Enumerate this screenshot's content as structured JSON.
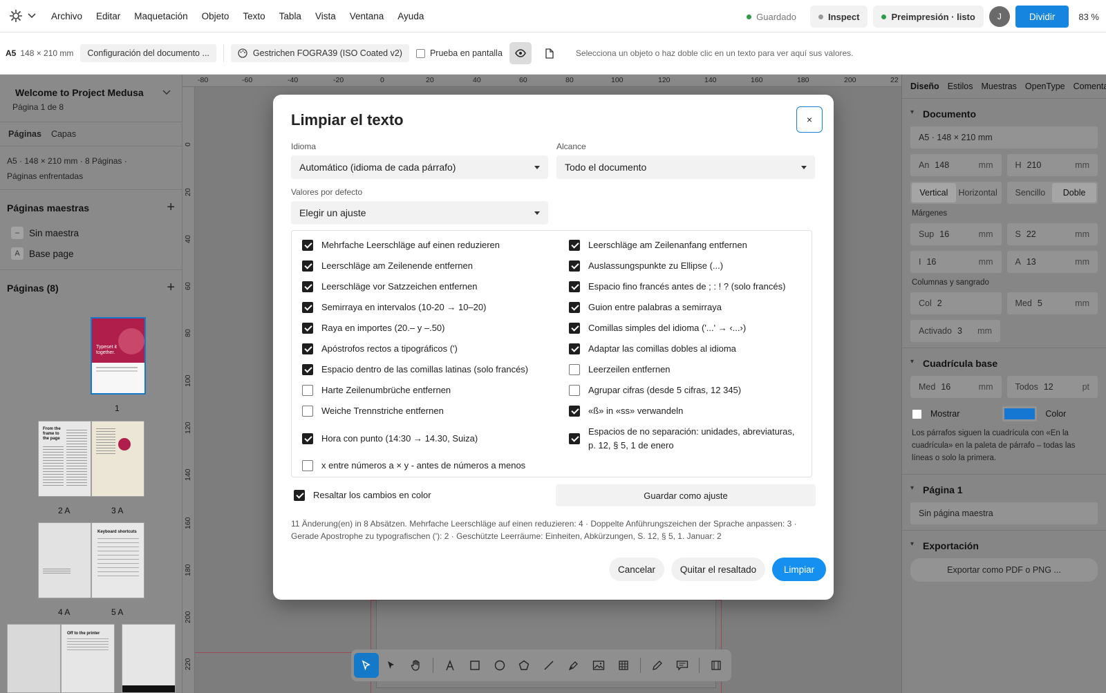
{
  "menubar": {
    "menu": [
      "Archivo",
      "Editar",
      "Maquetación",
      "Objeto",
      "Texto",
      "Tabla",
      "Vista",
      "Ventana",
      "Ayuda"
    ],
    "saved": "Guardado",
    "inspect": "Inspect",
    "preflight": "Preimpresión · listo",
    "avatar": "J",
    "share": "Dividir",
    "zoom": "83 %",
    "colors": {
      "accent": "#1685e0",
      "ok": "#2e9d4a"
    }
  },
  "toolbar": {
    "size_code": "A5",
    "size_dims": "148 × 210 mm",
    "doc_settings": "Configuración del documento ...",
    "profile": "Gestrichen FOGRA39 (ISO Coated v2)",
    "softproof": "Prueba en pantalla",
    "hint": "Selecciona un objeto o haz doble clic en un texto para ver aquí sus valores."
  },
  "left": {
    "doc_title": "Welcome to Project Medusa",
    "doc_page": "Página 1 de 8",
    "tabs": [
      "Páginas",
      "Capas"
    ],
    "meta_line1": "A5 · 148 × 210 mm  ·  8 Páginas ·",
    "meta_line2": "Páginas enfrentadas",
    "masters_title": "Páginas maestras",
    "masters": [
      {
        "tag": "–",
        "label": "Sin maestra"
      },
      {
        "tag": "A",
        "label": "Base page"
      }
    ],
    "pages_title": "Páginas (8)",
    "thumb_labels": [
      "1",
      "2 A",
      "3 A",
      "4 A",
      "5 A"
    ],
    "thumb_texts": {
      "p1": "Typeset it together.",
      "p2": "From the frame to the page",
      "p5": "Keyboard shortcuts",
      "p7": "Off to the printer"
    }
  },
  "canvas": {
    "ruler_top": [
      "-80",
      "-60",
      "-40",
      "-20",
      "0",
      "20",
      "40",
      "60",
      "80",
      "100",
      "120",
      "140",
      "160",
      "180",
      "200",
      "22"
    ],
    "ruler_left": [
      "0",
      "20",
      "40",
      "60",
      "80",
      "100",
      "120",
      "140",
      "160",
      "180",
      "200",
      "220",
      "40"
    ]
  },
  "dock": {
    "tools": [
      "select-icon",
      "direct-select-icon",
      "hand-icon",
      "text-icon",
      "rectangle-icon",
      "ellipse-icon",
      "polygon-icon",
      "line-icon",
      "pen-icon",
      "image-icon",
      "table-icon",
      "pencil-icon",
      "comment-icon",
      "frame-grid-icon"
    ]
  },
  "right": {
    "tabs": [
      "Diseño",
      "Estilos",
      "Muestras",
      "OpenType",
      "Comentarios"
    ],
    "doc_h": "Documento",
    "doc_size": "A5 · 148 × 210 mm",
    "width_lbl": "An",
    "width_val": "148",
    "height_lbl": "H",
    "height_val": "210",
    "unit": "mm",
    "orient": [
      "Vertical",
      "Horizontal"
    ],
    "sides": [
      "Sencillo",
      "Doble"
    ],
    "margins_lbl": "Márgenes",
    "m_top_lbl": "Sup",
    "m_top": "16",
    "m_s_lbl": "S",
    "m_s": "22",
    "m_i_lbl": "I",
    "m_i": "16",
    "m_a_lbl": "A",
    "m_a": "13",
    "cols_lbl": "Columnas y sangrado",
    "col_lbl": "Col",
    "col_val": "2",
    "gut_lbl": "Med",
    "gut_val": "5",
    "bleed_lbl": "Activado",
    "bleed_val": "3",
    "grid_h": "Cuadrícula base",
    "grid_med_lbl": "Med",
    "grid_med": "16",
    "grid_all_lbl": "Todos",
    "grid_all": "12",
    "grid_unit": "pt",
    "show_lbl": "Mostrar",
    "color_lbl": "Color",
    "grid_swatch": "#1677d2",
    "grid_note": "Los párrafos siguen la cuadrícula con «En la cuadrícula» en la paleta de párrafo – todas las líneas o solo la primera.",
    "page_h": "Página 1",
    "page_master": "Sin página maestra",
    "export_h": "Exportación",
    "export_btn": "Exportar como PDF o PNG ..."
  },
  "dialog": {
    "title": "Limpiar el texto",
    "close": "×",
    "lang_label": "Idioma",
    "lang_value": "Automático (idioma de cada párrafo)",
    "scope_label": "Alcance",
    "scope_value": "Todo el documento",
    "preset_label": "Valores por defecto",
    "preset_value": "Elegir un ajuste",
    "options_left": [
      {
        "label": "Mehrfache Leerschläge auf einen reduzieren",
        "checked": true
      },
      {
        "label": "Leerschläge am Zeilenende entfernen",
        "checked": true
      },
      {
        "label": "Leerschläge vor Satzzeichen entfernen",
        "checked": true
      },
      {
        "label": "Semirraya en intervalos (10-20 → 10–20)",
        "checked": true
      },
      {
        "label": "Raya en importes (20.– y –.50)",
        "checked": true
      },
      {
        "label": "Apóstrofos rectos a tipográficos (')",
        "checked": true
      },
      {
        "label": "Espacio dentro de las comillas latinas (solo francés)",
        "checked": true
      },
      {
        "label": "Harte Zeilenumbrüche entfernen",
        "checked": false
      },
      {
        "label": "Weiche Trennstriche entfernen",
        "checked": false
      },
      {
        "label": "Hora con punto (14:30 → 14.30, Suiza)",
        "checked": true
      },
      {
        "label": "x entre números a × y - antes de números a menos",
        "checked": false
      }
    ],
    "options_right": [
      {
        "label": "Leerschläge am Zeilenanfang entfernen",
        "checked": true
      },
      {
        "label": "Auslassungspunkte zu Ellipse (...)",
        "checked": true
      },
      {
        "label": "Espacio fino francés antes de ; : ! ? (solo francés)",
        "checked": true
      },
      {
        "label": "Guion entre palabras a semirraya",
        "checked": true
      },
      {
        "label": "Comillas simples del idioma ('...' → ‹...›)",
        "checked": true
      },
      {
        "label": "Adaptar las comillas dobles al idioma",
        "checked": true
      },
      {
        "label": "Leerzeilen entfernen",
        "checked": false
      },
      {
        "label": "Agrupar cifras (desde 5 cifras, 12 345)",
        "checked": false
      },
      {
        "label": "«ß» in «ss» verwandeln",
        "checked": true
      },
      {
        "label": "Espacios de no separación: unidades, abreviaturas, p. 12, § 5, 1 de enero",
        "checked": true
      }
    ],
    "highlight_label": "Resaltar los cambios en color",
    "highlight_checked": true,
    "save_preset": "Guardar como ajuste",
    "summary": "11 Änderung(en) in 8 Absätzen. Mehrfache Leerschläge auf einen reduzieren: 4 · Doppelte Anführungszeichen der Sprache anpassen: 3 · Gerade Apostrophe zu typografischen ('): 2 · Geschützte Leerräume: Einheiten, Abkürzungen, S. 12, § 5, 1. Januar: 2",
    "cancel": "Cancelar",
    "remove_highlight": "Quitar el resaltado",
    "apply": "Limpiar"
  }
}
